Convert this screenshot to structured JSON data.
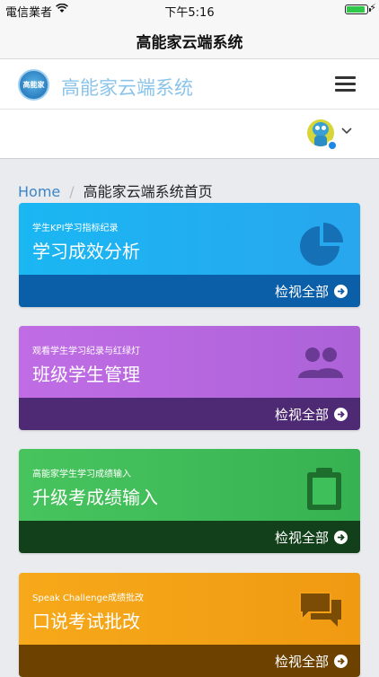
{
  "status_bar": {
    "carrier": "電信業者",
    "time": "下午5:16"
  },
  "navbar": {
    "title": "高能家云端系统"
  },
  "app_header": {
    "logo_text": "高能家",
    "title": "高能家云端系统"
  },
  "breadcrumb": {
    "home": "Home",
    "current": "高能家云端系统首页"
  },
  "colors": {
    "blue_top": "#1fb2f2",
    "blue_foot": "#0b5ea8",
    "purple_top": "#b86be0",
    "purple_foot": "#4e2a74",
    "green_top": "#3fbf5a",
    "green_foot": "#12401a",
    "orange_top": "#f4a118",
    "orange_foot": "#6d4200"
  },
  "cards": [
    {
      "subtitle": "学生KPI学习指标纪录",
      "title": "学习成效分析",
      "link": "检视全部",
      "icon": "pie-chart-icon"
    },
    {
      "subtitle": "观看学生学习纪录与红绿灯",
      "title": "班级学生管理",
      "link": "检视全部",
      "icon": "users-icon"
    },
    {
      "subtitle": "高能家学生学习成绩输入",
      "title": "升级考成绩输入",
      "link": "检视全部",
      "icon": "clipboard-icon"
    },
    {
      "subtitle": "Speak Challenge成绩批改",
      "title": "口说考试批改",
      "link": "检视全部",
      "icon": "chat-bubbles-icon"
    }
  ]
}
